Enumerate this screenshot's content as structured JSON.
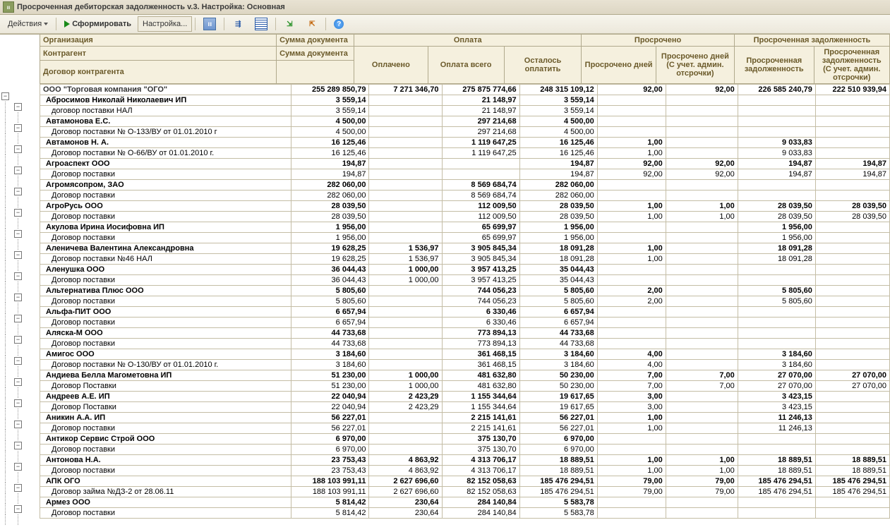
{
  "window": {
    "title": "Просроченная дебиторская задолженность v.3. Настройка: Основная"
  },
  "toolbar": {
    "actions_label": "Действия",
    "form_label": "Сформировать",
    "settings_label": "Настройка..."
  },
  "headers": {
    "org": "Организация",
    "contragent": "Контрагент",
    "contract": "Договор контрагента",
    "sum_doc": "Сумма документа",
    "payment": "Оплата",
    "paid": "Оплачено",
    "paid_total": "Оплата всего",
    "to_pay": "Осталось оплатить",
    "overdue": "Просрочено",
    "overdue_days": "Просрочено дней",
    "overdue_days_adm": "Просрочено дней (С учет. админ. отсрочки)",
    "overdue_debt": "Просроченная задолженность",
    "overdue_amount": "Просроченная задолженность",
    "overdue_amount_adm": "Просроченная задолженность (С учет. админ. отсрочки)"
  },
  "root": {
    "name": "ООО \"Торговая компания \"ОГО\"",
    "sum": "255 289 850,79",
    "paid": "7 271 346,70",
    "paid_total": "275 875 774,66",
    "to_pay": "248 315 109,12",
    "od": "92,00",
    "oda": "92,00",
    "oa": "226 585 240,79",
    "oaa": "222 510 939,94"
  },
  "rows": [
    {
      "lvl": 1,
      "b": 1,
      "name": "Абросимов Николай Николаевич ИП",
      "sum": "3 559,14",
      "paid": "",
      "pt": "21 148,97",
      "tp": "3 559,14",
      "od": "",
      "oda": "",
      "oa": "",
      "oaa": ""
    },
    {
      "lvl": 2,
      "b": 0,
      "name": "договор поставки НАЛ",
      "sum": "3 559,14",
      "paid": "",
      "pt": "21 148,97",
      "tp": "3 559,14",
      "od": "",
      "oda": "",
      "oa": "",
      "oaa": ""
    },
    {
      "lvl": 1,
      "b": 1,
      "name": "Автамонова Е.С.",
      "sum": "4 500,00",
      "paid": "",
      "pt": "297 214,68",
      "tp": "4 500,00",
      "od": "",
      "oda": "",
      "oa": "",
      "oaa": ""
    },
    {
      "lvl": 2,
      "b": 0,
      "name": "Договор поставки № О-133/ВУ от 01.01.2010 г",
      "sum": "4 500,00",
      "paid": "",
      "pt": "297 214,68",
      "tp": "4 500,00",
      "od": "",
      "oda": "",
      "oa": "",
      "oaa": ""
    },
    {
      "lvl": 1,
      "b": 1,
      "name": "Автамонов Н. А.",
      "sum": "16 125,46",
      "paid": "",
      "pt": "1 119 647,25",
      "tp": "16 125,46",
      "od": "1,00",
      "oda": "",
      "oa": "9 033,83",
      "oaa": ""
    },
    {
      "lvl": 2,
      "b": 0,
      "name": "Договор поставки № О-66/ВУ от 01.01.2010 г.",
      "sum": "16 125,46",
      "paid": "",
      "pt": "1 119 647,25",
      "tp": "16 125,46",
      "od": "1,00",
      "oda": "",
      "oa": "9 033,83",
      "oaa": ""
    },
    {
      "lvl": 1,
      "b": 1,
      "name": "Агроаспект ООО",
      "sum": "194,87",
      "paid": "",
      "pt": "",
      "tp": "194,87",
      "od": "92,00",
      "oda": "92,00",
      "oa": "194,87",
      "oaa": "194,87"
    },
    {
      "lvl": 2,
      "b": 0,
      "name": "Договор поставки",
      "sum": "194,87",
      "paid": "",
      "pt": "",
      "tp": "194,87",
      "od": "92,00",
      "oda": "92,00",
      "oa": "194,87",
      "oaa": "194,87"
    },
    {
      "lvl": 1,
      "b": 1,
      "name": "Агромясопром, ЗАО",
      "sum": "282 060,00",
      "paid": "",
      "pt": "8 569 684,74",
      "tp": "282 060,00",
      "od": "",
      "oda": "",
      "oa": "",
      "oaa": ""
    },
    {
      "lvl": 2,
      "b": 0,
      "name": "Договор поставки",
      "sum": "282 060,00",
      "paid": "",
      "pt": "8 569 684,74",
      "tp": "282 060,00",
      "od": "",
      "oda": "",
      "oa": "",
      "oaa": ""
    },
    {
      "lvl": 1,
      "b": 1,
      "name": "АгроРусь ООО",
      "sum": "28 039,50",
      "paid": "",
      "pt": "112 009,50",
      "tp": "28 039,50",
      "od": "1,00",
      "oda": "1,00",
      "oa": "28 039,50",
      "oaa": "28 039,50"
    },
    {
      "lvl": 2,
      "b": 0,
      "name": "Договор поставки",
      "sum": "28 039,50",
      "paid": "",
      "pt": "112 009,50",
      "tp": "28 039,50",
      "od": "1,00",
      "oda": "1,00",
      "oa": "28 039,50",
      "oaa": "28 039,50"
    },
    {
      "lvl": 1,
      "b": 1,
      "name": "Акулова Ирина Иосифовна ИП",
      "sum": "1 956,00",
      "paid": "",
      "pt": "65 699,97",
      "tp": "1 956,00",
      "od": "",
      "oda": "",
      "oa": "1 956,00",
      "oaa": ""
    },
    {
      "lvl": 2,
      "b": 0,
      "name": "Договор поставки",
      "sum": "1 956,00",
      "paid": "",
      "pt": "65 699,97",
      "tp": "1 956,00",
      "od": "",
      "oda": "",
      "oa": "1 956,00",
      "oaa": ""
    },
    {
      "lvl": 1,
      "b": 1,
      "name": "Аленичева Валентина Александровна",
      "sum": "19 628,25",
      "paid": "1 536,97",
      "pt": "3 905 845,34",
      "tp": "18 091,28",
      "od": "1,00",
      "oda": "",
      "oa": "18 091,28",
      "oaa": ""
    },
    {
      "lvl": 2,
      "b": 0,
      "name": "Договор поставки №46 НАЛ",
      "sum": "19 628,25",
      "paid": "1 536,97",
      "pt": "3 905 845,34",
      "tp": "18 091,28",
      "od": "1,00",
      "oda": "",
      "oa": "18 091,28",
      "oaa": ""
    },
    {
      "lvl": 1,
      "b": 1,
      "name": "Аленушка ООО",
      "sum": "36 044,43",
      "paid": "1 000,00",
      "pt": "3 957 413,25",
      "tp": "35 044,43",
      "od": "",
      "oda": "",
      "oa": "",
      "oaa": ""
    },
    {
      "lvl": 2,
      "b": 0,
      "name": "Договор поставки",
      "sum": "36 044,43",
      "paid": "1 000,00",
      "pt": "3 957 413,25",
      "tp": "35 044,43",
      "od": "",
      "oda": "",
      "oa": "",
      "oaa": ""
    },
    {
      "lvl": 1,
      "b": 1,
      "name": "Альтернатива Плюс ООО",
      "sum": "5 805,60",
      "paid": "",
      "pt": "744 056,23",
      "tp": "5 805,60",
      "od": "2,00",
      "oda": "",
      "oa": "5 805,60",
      "oaa": ""
    },
    {
      "lvl": 2,
      "b": 0,
      "name": "Договор поставки",
      "sum": "5 805,60",
      "paid": "",
      "pt": "744 056,23",
      "tp": "5 805,60",
      "od": "2,00",
      "oda": "",
      "oa": "5 805,60",
      "oaa": ""
    },
    {
      "lvl": 1,
      "b": 1,
      "name": "Альфа-ПИТ ООО",
      "sum": "6 657,94",
      "paid": "",
      "pt": "6 330,46",
      "tp": "6 657,94",
      "od": "",
      "oda": "",
      "oa": "",
      "oaa": ""
    },
    {
      "lvl": 2,
      "b": 0,
      "name": "Договор поставки",
      "sum": "6 657,94",
      "paid": "",
      "pt": "6 330,46",
      "tp": "6 657,94",
      "od": "",
      "oda": "",
      "oa": "",
      "oaa": ""
    },
    {
      "lvl": 1,
      "b": 1,
      "name": "Аляска-М ООО",
      "sum": "44 733,68",
      "paid": "",
      "pt": "773 894,13",
      "tp": "44 733,68",
      "od": "",
      "oda": "",
      "oa": "",
      "oaa": ""
    },
    {
      "lvl": 2,
      "b": 0,
      "name": "Договор поставки",
      "sum": "44 733,68",
      "paid": "",
      "pt": "773 894,13",
      "tp": "44 733,68",
      "od": "",
      "oda": "",
      "oa": "",
      "oaa": ""
    },
    {
      "lvl": 1,
      "b": 1,
      "name": "Амигос ООО",
      "sum": "3 184,60",
      "paid": "",
      "pt": "361 468,15",
      "tp": "3 184,60",
      "od": "4,00",
      "oda": "",
      "oa": "3 184,60",
      "oaa": ""
    },
    {
      "lvl": 2,
      "b": 0,
      "name": "Договор поставки № О-130/ВУ от 01.01.2010 г.",
      "sum": "3 184,60",
      "paid": "",
      "pt": "361 468,15",
      "tp": "3 184,60",
      "od": "4,00",
      "oda": "",
      "oa": "3 184,60",
      "oaa": ""
    },
    {
      "lvl": 1,
      "b": 1,
      "name": "Андиева Белла Магометовна ИП",
      "sum": "51 230,00",
      "paid": "1 000,00",
      "pt": "481 632,80",
      "tp": "50 230,00",
      "od": "7,00",
      "oda": "7,00",
      "oa": "27 070,00",
      "oaa": "27 070,00"
    },
    {
      "lvl": 2,
      "b": 0,
      "name": "Договор Поставки",
      "sum": "51 230,00",
      "paid": "1 000,00",
      "pt": "481 632,80",
      "tp": "50 230,00",
      "od": "7,00",
      "oda": "7,00",
      "oa": "27 070,00",
      "oaa": "27 070,00"
    },
    {
      "lvl": 1,
      "b": 1,
      "name": "Андреев А.Е. ИП",
      "sum": "22 040,94",
      "paid": "2 423,29",
      "pt": "1 155 344,64",
      "tp": "19 617,65",
      "od": "3,00",
      "oda": "",
      "oa": "3 423,15",
      "oaa": ""
    },
    {
      "lvl": 2,
      "b": 0,
      "name": "Договор Поставки",
      "sum": "22 040,94",
      "paid": "2 423,29",
      "pt": "1 155 344,64",
      "tp": "19 617,65",
      "od": "3,00",
      "oda": "",
      "oa": "3 423,15",
      "oaa": ""
    },
    {
      "lvl": 1,
      "b": 1,
      "name": "Аникин А.А. ИП",
      "sum": "56 227,01",
      "paid": "",
      "pt": "2 215 141,61",
      "tp": "56 227,01",
      "od": "1,00",
      "oda": "",
      "oa": "11 246,13",
      "oaa": ""
    },
    {
      "lvl": 2,
      "b": 0,
      "name": "Договор поставки",
      "sum": "56 227,01",
      "paid": "",
      "pt": "2 215 141,61",
      "tp": "56 227,01",
      "od": "1,00",
      "oda": "",
      "oa": "11 246,13",
      "oaa": ""
    },
    {
      "lvl": 1,
      "b": 1,
      "name": "Антикор Сервис Строй ООО",
      "sum": "6 970,00",
      "paid": "",
      "pt": "375 130,70",
      "tp": "6 970,00",
      "od": "",
      "oda": "",
      "oa": "",
      "oaa": ""
    },
    {
      "lvl": 2,
      "b": 0,
      "name": "Договор поставки",
      "sum": "6 970,00",
      "paid": "",
      "pt": "375 130,70",
      "tp": "6 970,00",
      "od": "",
      "oda": "",
      "oa": "",
      "oaa": ""
    },
    {
      "lvl": 1,
      "b": 1,
      "name": "Антонова Н.А.",
      "sum": "23 753,43",
      "paid": "4 863,92",
      "pt": "4 313 706,17",
      "tp": "18 889,51",
      "od": "1,00",
      "oda": "1,00",
      "oa": "18 889,51",
      "oaa": "18 889,51"
    },
    {
      "lvl": 2,
      "b": 0,
      "name": "Договор поставки",
      "sum": "23 753,43",
      "paid": "4 863,92",
      "pt": "4 313 706,17",
      "tp": "18 889,51",
      "od": "1,00",
      "oda": "1,00",
      "oa": "18 889,51",
      "oaa": "18 889,51"
    },
    {
      "lvl": 1,
      "b": 1,
      "name": "АПК ОГО",
      "sum": "188 103 991,11",
      "paid": "2 627 696,60",
      "pt": "82 152 058,63",
      "tp": "185 476 294,51",
      "od": "79,00",
      "oda": "79,00",
      "oa": "185 476 294,51",
      "oaa": "185 476 294,51"
    },
    {
      "lvl": 2,
      "b": 0,
      "name": "Договор займа №ДЗ-2 от 28.06.11",
      "sum": "188 103 991,11",
      "paid": "2 627 696,60",
      "pt": "82 152 058,63",
      "tp": "185 476 294,51",
      "od": "79,00",
      "oda": "79,00",
      "oa": "185 476 294,51",
      "oaa": "185 476 294,51"
    },
    {
      "lvl": 1,
      "b": 1,
      "name": "Армез ООО",
      "sum": "5 814,42",
      "paid": "230,64",
      "pt": "284 140,84",
      "tp": "5 583,78",
      "od": "",
      "oda": "",
      "oa": "",
      "oaa": ""
    },
    {
      "lvl": 2,
      "b": 0,
      "name": "Договор поставки",
      "sum": "5 814,42",
      "paid": "230,64",
      "pt": "284 140,84",
      "tp": "5 583,78",
      "od": "",
      "oda": "",
      "oa": "",
      "oaa": ""
    }
  ]
}
